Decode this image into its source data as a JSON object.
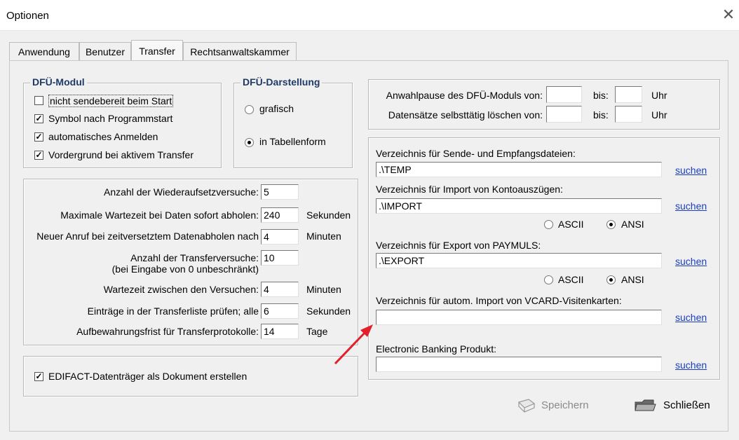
{
  "window": {
    "title": "Optionen"
  },
  "tabs": [
    "Anwendung",
    "Benutzer",
    "Transfer",
    "Rechtsanwaltskammer"
  ],
  "dfu_modul": {
    "legend": "DFÜ-Modul",
    "checks": [
      {
        "label": "nicht sendebereit beim Start",
        "checked": false
      },
      {
        "label": "Symbol nach Programmstart",
        "checked": true
      },
      {
        "label": "automatisches Anmelden",
        "checked": true
      },
      {
        "label": "Vordergrund bei aktivem Transfer",
        "checked": true
      }
    ]
  },
  "dfu_darstellung": {
    "legend": "DFÜ-Darstellung",
    "options": [
      {
        "label": "grafisch",
        "selected": false
      },
      {
        "label": "in Tabellenform",
        "selected": true
      }
    ]
  },
  "settings": {
    "rows": [
      {
        "label": "Anzahl der Wiederaufsetzversuche:",
        "value": "5",
        "unit": ""
      },
      {
        "label": "Maximale Wartezeit bei Daten sofort abholen:",
        "value": "240",
        "unit": "Sekunden"
      },
      {
        "label": "Neuer Anruf bei zeitversetztem Datenabholen nach",
        "value": "4",
        "unit": "Minuten"
      },
      {
        "label": "Anzahl der Transferversuche:",
        "value": "10",
        "unit": ""
      },
      {
        "label": "Wartezeit zwischen den Versuchen:",
        "value": "4",
        "unit": "Minuten"
      },
      {
        "label": "Einträge in der Transferliste prüfen; alle",
        "value": "6",
        "unit": "Sekunden"
      },
      {
        "label": "Aufbewahrungsfrist für Transferprotokolle:",
        "value": "14",
        "unit": "Tage"
      }
    ],
    "note": "(bei Eingabe von 0 unbeschränkt)"
  },
  "edifact": {
    "label": "EDIFACT-Datenträger als Dokument erstellen",
    "checked": true
  },
  "anwahl": {
    "row1_label": "Anwahlpause des DFÜ-Moduls von:",
    "row2_label": "Datensätze selbsttätig löschen von:",
    "bis": "bis:",
    "uhr": "Uhr",
    "from1": "",
    "to1": "",
    "from2": "",
    "to2": ""
  },
  "dirs": {
    "sende_label": "Verzeichnis für Sende- und Empfangsdateien:",
    "sende_value": ".\\TEMP",
    "import_label": "Verzeichnis für Import von Kontoauszügen:",
    "import_value": ".\\IMPORT",
    "export_label": "Verzeichnis für Export von PAYMULS:",
    "export_value": ".\\EXPORT",
    "vcard_label": "Verzeichnis für autom. Import von VCARD-Visitenkarten:",
    "vcard_value": "",
    "ebank_label": "Electronic Banking Produkt:",
    "ebank_value": "",
    "suchen": "suchen",
    "ascii": "ASCII",
    "ansi": "ANSI",
    "import_encoding": "ANSI",
    "export_encoding": "ANSI"
  },
  "buttons": {
    "save": "Speichern",
    "close": "Schließen"
  },
  "colors": {
    "legend": "#1f3a66",
    "link": "#1a3fbf",
    "arrow": "#e0202a"
  }
}
